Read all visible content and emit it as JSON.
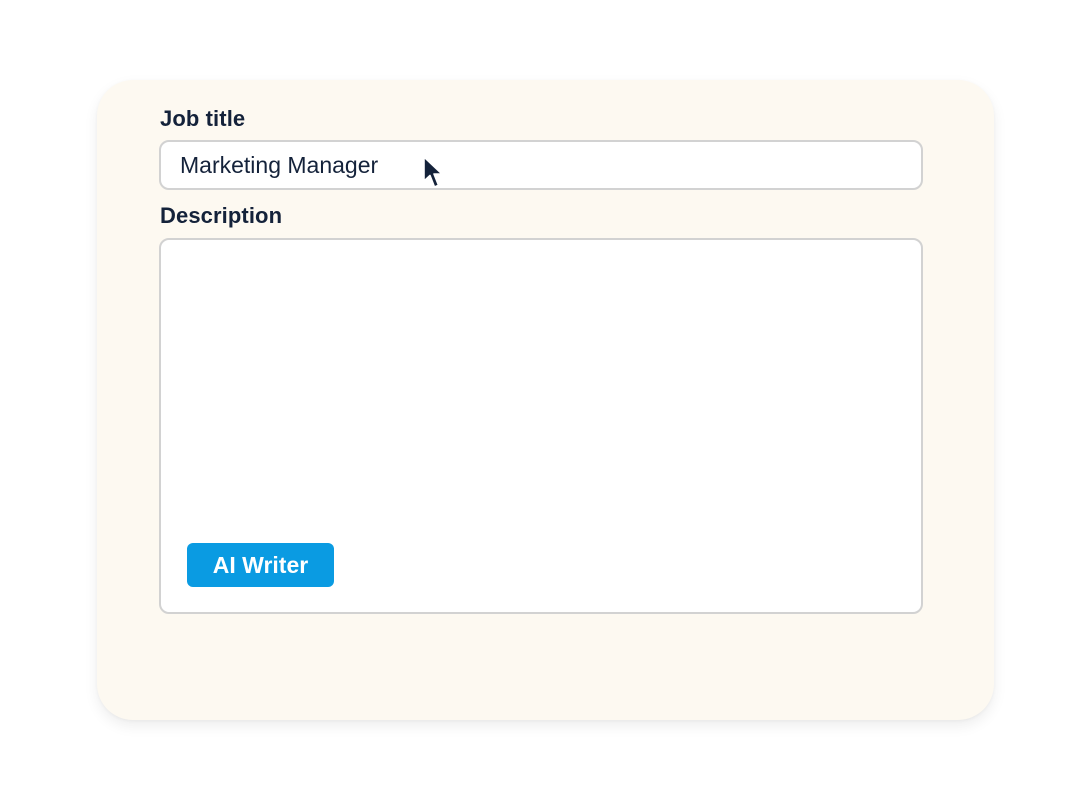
{
  "form": {
    "job_title": {
      "label": "Job title",
      "value": "Marketing Manager"
    },
    "description": {
      "label": "Description",
      "value": ""
    },
    "ai_writer_button": {
      "label": "AI Writer"
    }
  },
  "colors": {
    "card_background": "#fdf9f1",
    "label_text": "#14223a",
    "field_border": "#d2d2d2",
    "accent_button": "#0a9be2",
    "button_text": "#ffffff"
  },
  "icons": {
    "cursor": "mouse-pointer-icon"
  }
}
